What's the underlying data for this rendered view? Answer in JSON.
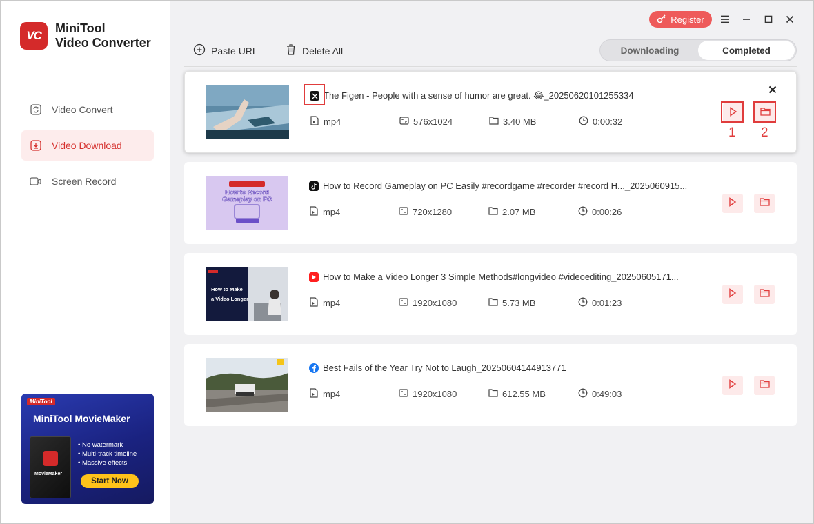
{
  "app": {
    "name_line1": "MiniTool",
    "name_line2": "Video Converter",
    "logo_text": "VC"
  },
  "sidebar": {
    "items": [
      {
        "label": "Video Convert",
        "icon": "convert-icon",
        "active": false
      },
      {
        "label": "Video Download",
        "icon": "download-icon",
        "active": true
      },
      {
        "label": "Screen Record",
        "icon": "camera-icon",
        "active": false
      }
    ]
  },
  "promo": {
    "brand": "MiniTool",
    "title": "MiniTool MovieMaker",
    "box_label": "MovieMaker",
    "features": [
      "No watermark",
      "Multi-track timeline",
      "Massive effects"
    ],
    "cta": "Start Now"
  },
  "titlebar": {
    "register": "Register"
  },
  "toolbar": {
    "paste_url": "Paste URL",
    "delete_all": "Delete All"
  },
  "tabs": {
    "downloading": "Downloading",
    "completed": "Completed",
    "active": "Completed"
  },
  "downloads": [
    {
      "source": "x",
      "title": "The Figen - People with a sense of humor are great. 😂_20250620101255334",
      "format": "mp4",
      "resolution": "576x1024",
      "size": "3.40 MB",
      "duration": "0:00:32"
    },
    {
      "source": "tiktok",
      "title": "How to Record Gameplay on PC Easily #recordgame #recorder #record  H..._2025060915...",
      "format": "mp4",
      "resolution": "720x1280",
      "size": "2.07 MB",
      "duration": "0:00:26"
    },
    {
      "source": "youtube",
      "title": "How to Make a Video Longer 3 Simple Methods#longvideo #videoediting_20250605171...",
      "format": "mp4",
      "resolution": "1920x1080",
      "size": "5.73 MB",
      "duration": "0:01:23"
    },
    {
      "source": "facebook",
      "title": "Best Fails of the Year   Try Not to Laugh_20250604144913771",
      "format": "mp4",
      "resolution": "1920x1080",
      "size": "612.55 MB",
      "duration": "0:49:03"
    }
  ],
  "thumb_text": {
    "t2_line1": "How to Record",
    "t2_line2": "Gameplay on PC",
    "t3_line1": "How to Make",
    "t3_line2": "a Video Longer"
  },
  "annotations": {
    "label1": "1",
    "label2": "2"
  },
  "colors": {
    "accent": "#d6322f",
    "register_bg": "#ee5a5a",
    "highlight": "#e03c3c"
  }
}
